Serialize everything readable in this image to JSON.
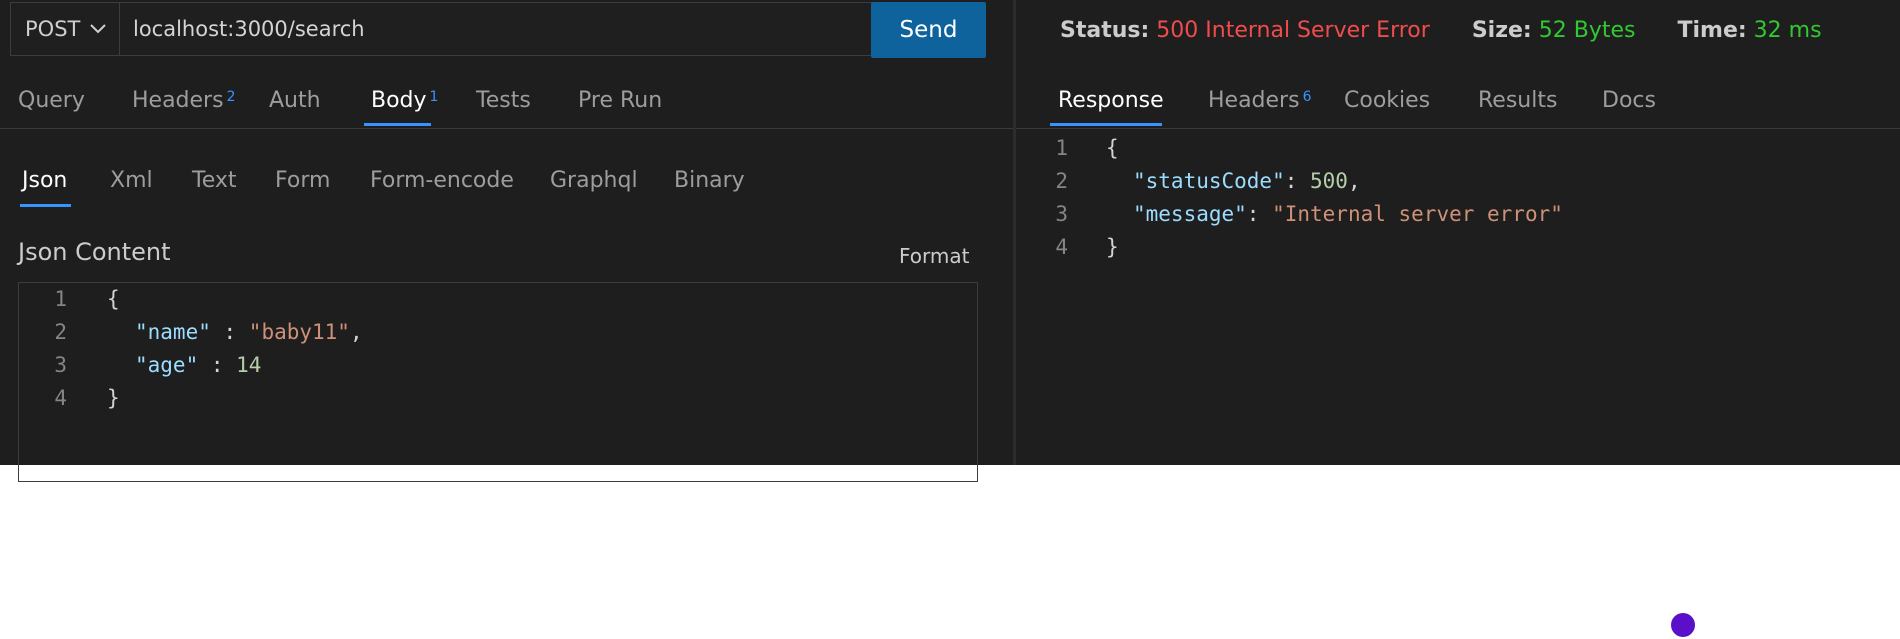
{
  "request": {
    "method": "POST",
    "url": "localhost:3000/search",
    "send_label": "Send"
  },
  "request_tabs": [
    {
      "label": "Query",
      "badge": ""
    },
    {
      "label": "Headers",
      "badge": "2"
    },
    {
      "label": "Auth",
      "badge": ""
    },
    {
      "label": "Body",
      "badge": "1",
      "active": true
    },
    {
      "label": "Tests",
      "badge": ""
    },
    {
      "label": "Pre Run",
      "badge": ""
    }
  ],
  "body_tabs": [
    "Json",
    "Xml",
    "Text",
    "Form",
    "Form-encode",
    "Graphql",
    "Binary"
  ],
  "body": {
    "label": "Json Content",
    "format_label": "Format",
    "line_numbers": [
      "1",
      "2",
      "3",
      "4"
    ],
    "lines": [
      {
        "open": "{"
      },
      {
        "key": "\"name\"",
        "sep": " : ",
        "str": "\"baby11\"",
        "end": ","
      },
      {
        "key": "\"age\"",
        "sep": " : ",
        "num": "14"
      },
      {
        "close": "}"
      }
    ]
  },
  "response_status": {
    "status_label": "Status:",
    "status_value": "500 Internal Server Error",
    "size_label": "Size:",
    "size_value": "52 Bytes",
    "time_label": "Time:",
    "time_value": "32 ms"
  },
  "response_tabs": [
    {
      "label": "Response",
      "badge": "",
      "active": true
    },
    {
      "label": "Headers",
      "badge": "6"
    },
    {
      "label": "Cookies",
      "badge": ""
    },
    {
      "label": "Results",
      "badge": ""
    },
    {
      "label": "Docs",
      "badge": ""
    }
  ],
  "response": {
    "line_numbers": [
      "1",
      "2",
      "3",
      "4"
    ],
    "open": "{",
    "status_key": "\"statusCode\"",
    "status_sep": ": ",
    "status_num": "500",
    "comma": ",",
    "message_key": "\"message\"",
    "message_sep": ": ",
    "message_str": "\"Internal server error\"",
    "close": "}"
  },
  "colors": {
    "accent": "#3794ff",
    "send": "#0e639c",
    "error": "#f14c4c",
    "success": "#32c832",
    "cursor_dot": "#5a0fc8"
  }
}
